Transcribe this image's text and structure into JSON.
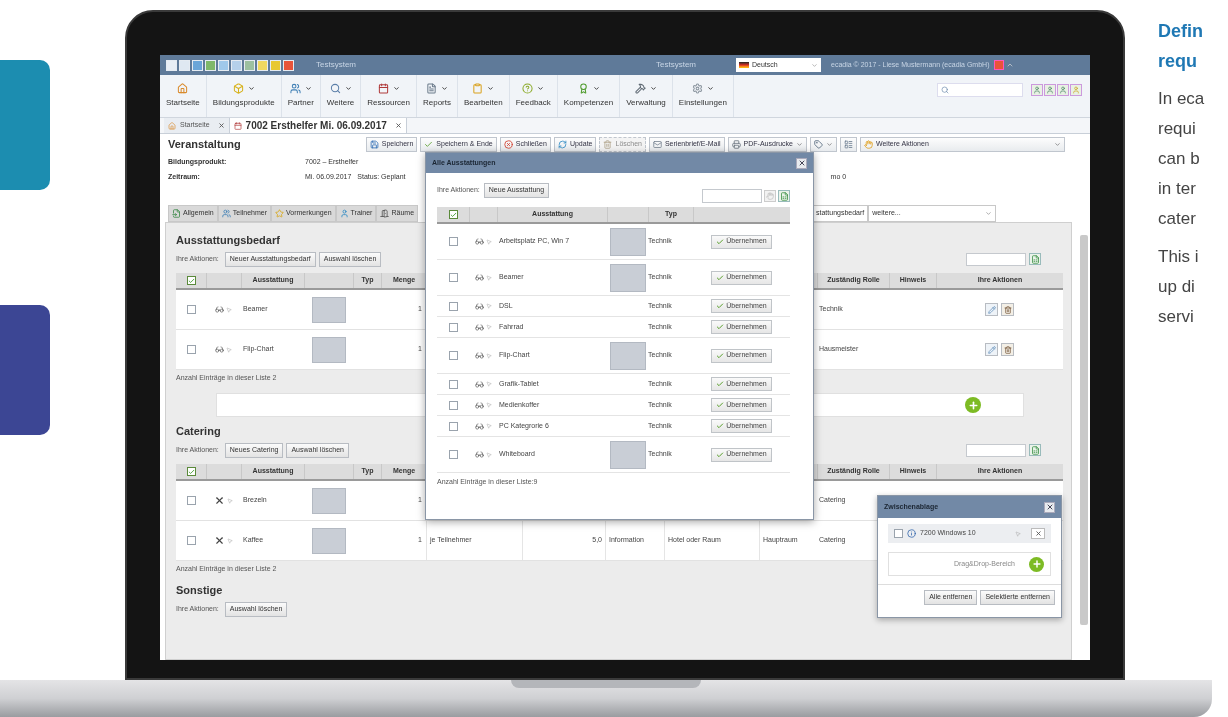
{
  "titlebar": {
    "app_title": "Testsystem",
    "center_title": "Testsystem",
    "language": "Deutsch",
    "user_info": "ecadia © 2017 - Liese Mustermann (ecadia GmbH)"
  },
  "menu": [
    {
      "label": "Startseite",
      "dropdown": false
    },
    {
      "label": "Bildungsprodukte",
      "dropdown": true
    },
    {
      "label": "Partner",
      "dropdown": true
    },
    {
      "label": "Weitere",
      "dropdown": true
    },
    {
      "label": "Ressourcen",
      "dropdown": true
    },
    {
      "label": "Reports",
      "dropdown": true
    },
    {
      "label": "Bearbeiten",
      "dropdown": true
    },
    {
      "label": "Feedback",
      "dropdown": true
    },
    {
      "label": "Kompetenzen",
      "dropdown": true
    },
    {
      "label": "Verwaltung",
      "dropdown": true
    },
    {
      "label": "Einstellungen",
      "dropdown": true
    }
  ],
  "doc_tabs": [
    {
      "label": "Startseite",
      "selected": false
    },
    {
      "label": "7002 Ersthelfer Mi. 06.09.2017",
      "selected": true
    }
  ],
  "record": {
    "title": "Veranstaltung",
    "actions": [
      {
        "kind": "save",
        "label": "Speichern",
        "disabled": false,
        "dropdown": false
      },
      {
        "kind": "check",
        "label": "Speichern & Ende",
        "disabled": false,
        "dropdown": false
      },
      {
        "kind": "close",
        "label": "Schließen",
        "disabled": false,
        "dropdown": false
      },
      {
        "kind": "refresh",
        "label": "Update",
        "disabled": false,
        "dropdown": false
      },
      {
        "kind": "trash",
        "label": "Löschen",
        "disabled": true,
        "dropdown": false
      },
      {
        "kind": "mail",
        "label": "Serienbrief/E-Mail",
        "disabled": false,
        "dropdown": false
      },
      {
        "kind": "print",
        "label": "PDF-Ausdrucke",
        "disabled": false,
        "dropdown": true
      },
      {
        "kind": "tag",
        "disabled": false,
        "dropdown": true
      },
      {
        "kind": "view",
        "disabled": false,
        "dropdown": false
      },
      {
        "kind": "hand",
        "label": "Weitere Aktionen",
        "disabled": false,
        "dropdown": true
      }
    ],
    "fields": [
      {
        "label": "Bildungsprodukt:",
        "value": "7002 – Ersthelfer"
      },
      {
        "label": "Zeitraum:",
        "value": "Mi. 06.09.2017",
        "extra": "Status: Geplant"
      }
    ],
    "side_text": "mo 0"
  },
  "sub_tabs": [
    {
      "label": "Allgemein",
      "selected": false
    },
    {
      "label": "Teilnehmer",
      "selected": false
    },
    {
      "label": "Vormerkungen",
      "selected": false
    },
    {
      "label": "Trainer",
      "selected": false
    },
    {
      "label": "Räume",
      "selected": false
    },
    {
      "label": "stattungsbedarf",
      "selected": true
    }
  ],
  "sub_tab_more": "weitere...",
  "sections": [
    {
      "title": "Ausstattungsbedarf",
      "actions_label": "Ihre Aktionen:",
      "buttons": [
        "Neuer Ausstattungsbedarf",
        "Auswahl löschen"
      ],
      "search": true,
      "select_all": true,
      "columns": [
        "Ausstattung",
        "Typ",
        "Menge",
        "Zuständig Rolle",
        "Hinweis",
        "Ihre Aktionen"
      ],
      "rows": [
        {
          "kind": "equipment",
          "checked": false,
          "name": "Beamer",
          "photo": true,
          "quantity": "1",
          "details": [],
          "role": "Technik",
          "actions": true
        },
        {
          "kind": "equipment",
          "checked": false,
          "name": "Flip-Chart",
          "photo": true,
          "quantity": "1",
          "details": [],
          "role": "Hausmeister",
          "actions": true
        }
      ],
      "count": "Anzahl Einträge in dieser Liste 2",
      "dropzone": true
    },
    {
      "title": "Catering",
      "actions_label": "Ihre Aktionen:",
      "buttons": [
        "Neues Catering",
        "Auswahl löschen"
      ],
      "search": true,
      "select_all": true,
      "columns": [
        "Ausstattung",
        "Typ",
        "Menge",
        "Zuständig Rolle",
        "Hinweis",
        "Ihre Aktionen"
      ],
      "rows": [
        {
          "kind": "catering",
          "checked": false,
          "name": "Brezeln",
          "photo": true,
          "quantity": "1",
          "details": [],
          "role": "Catering",
          "actions": false
        },
        {
          "kind": "catering",
          "checked": false,
          "name": "Kaffee",
          "photo": true,
          "quantity": "1",
          "details": [
            "je Teilnehmer",
            "5,0",
            "Information",
            "Hotel oder Raum",
            "Hauptraum"
          ],
          "role": "Catering",
          "actions": false
        }
      ],
      "count": "Anzahl Einträge in dieser Liste 2",
      "dropzone": false
    },
    {
      "title": "Sonstige",
      "actions_label": "Ihre Aktionen:",
      "buttons": [
        "Auswahl löschen"
      ],
      "search": false
    }
  ],
  "dialog": {
    "title": "Alle Ausstattungen",
    "actions_label": "Ihre Aktionen:",
    "new_button": "Neue Ausstattung",
    "select_all": true,
    "columns": [
      "Ausstattung",
      "Typ"
    ],
    "rows": [
      {
        "checked": false,
        "name": "Arbeitsplatz PC, Win 7",
        "photo": true,
        "type": "Technik",
        "button": "Übernehmen"
      },
      {
        "checked": false,
        "name": "Beamer",
        "photo": true,
        "type": "Technik",
        "button": "Übernehmen"
      },
      {
        "checked": false,
        "name": "DSL",
        "photo": false,
        "type": "Technik",
        "button": "Übernehmen"
      },
      {
        "checked": false,
        "name": "Fahrrad",
        "photo": false,
        "type": "Technik",
        "button": "Übernehmen"
      },
      {
        "checked": false,
        "name": "Flip-Chart",
        "photo": true,
        "type": "Technik",
        "button": "Übernehmen"
      },
      {
        "checked": false,
        "name": "Grafik-Tablet",
        "photo": false,
        "type": "Technik",
        "button": "Übernehmen"
      },
      {
        "checked": false,
        "name": "Medienkoffer",
        "photo": false,
        "type": "Technik",
        "button": "Übernehmen"
      },
      {
        "checked": false,
        "name": "PC Kategrorie 6",
        "photo": false,
        "type": "Technik",
        "button": "Übernehmen"
      },
      {
        "checked": false,
        "name": "Whiteboard",
        "photo": true,
        "type": "Technik",
        "button": "Übernehmen"
      }
    ],
    "count": "Anzahl Einträge in dieser Liste:9"
  },
  "clipboard": {
    "title": "Zwischenablage",
    "items": [
      {
        "checked": false,
        "label": "7200 Windows 10"
      }
    ],
    "dropzone": "Drag&Drop-Bereich",
    "buttons": [
      "Alle entfernen",
      "Selektierte entfernen"
    ]
  },
  "promo": {
    "heading": [
      "Defin",
      "requ"
    ],
    "paragraphs": [
      [
        "In eca",
        "requi",
        "can b",
        "in ter",
        "cater"
      ],
      [
        "This i",
        "up di",
        "servi"
      ]
    ]
  }
}
